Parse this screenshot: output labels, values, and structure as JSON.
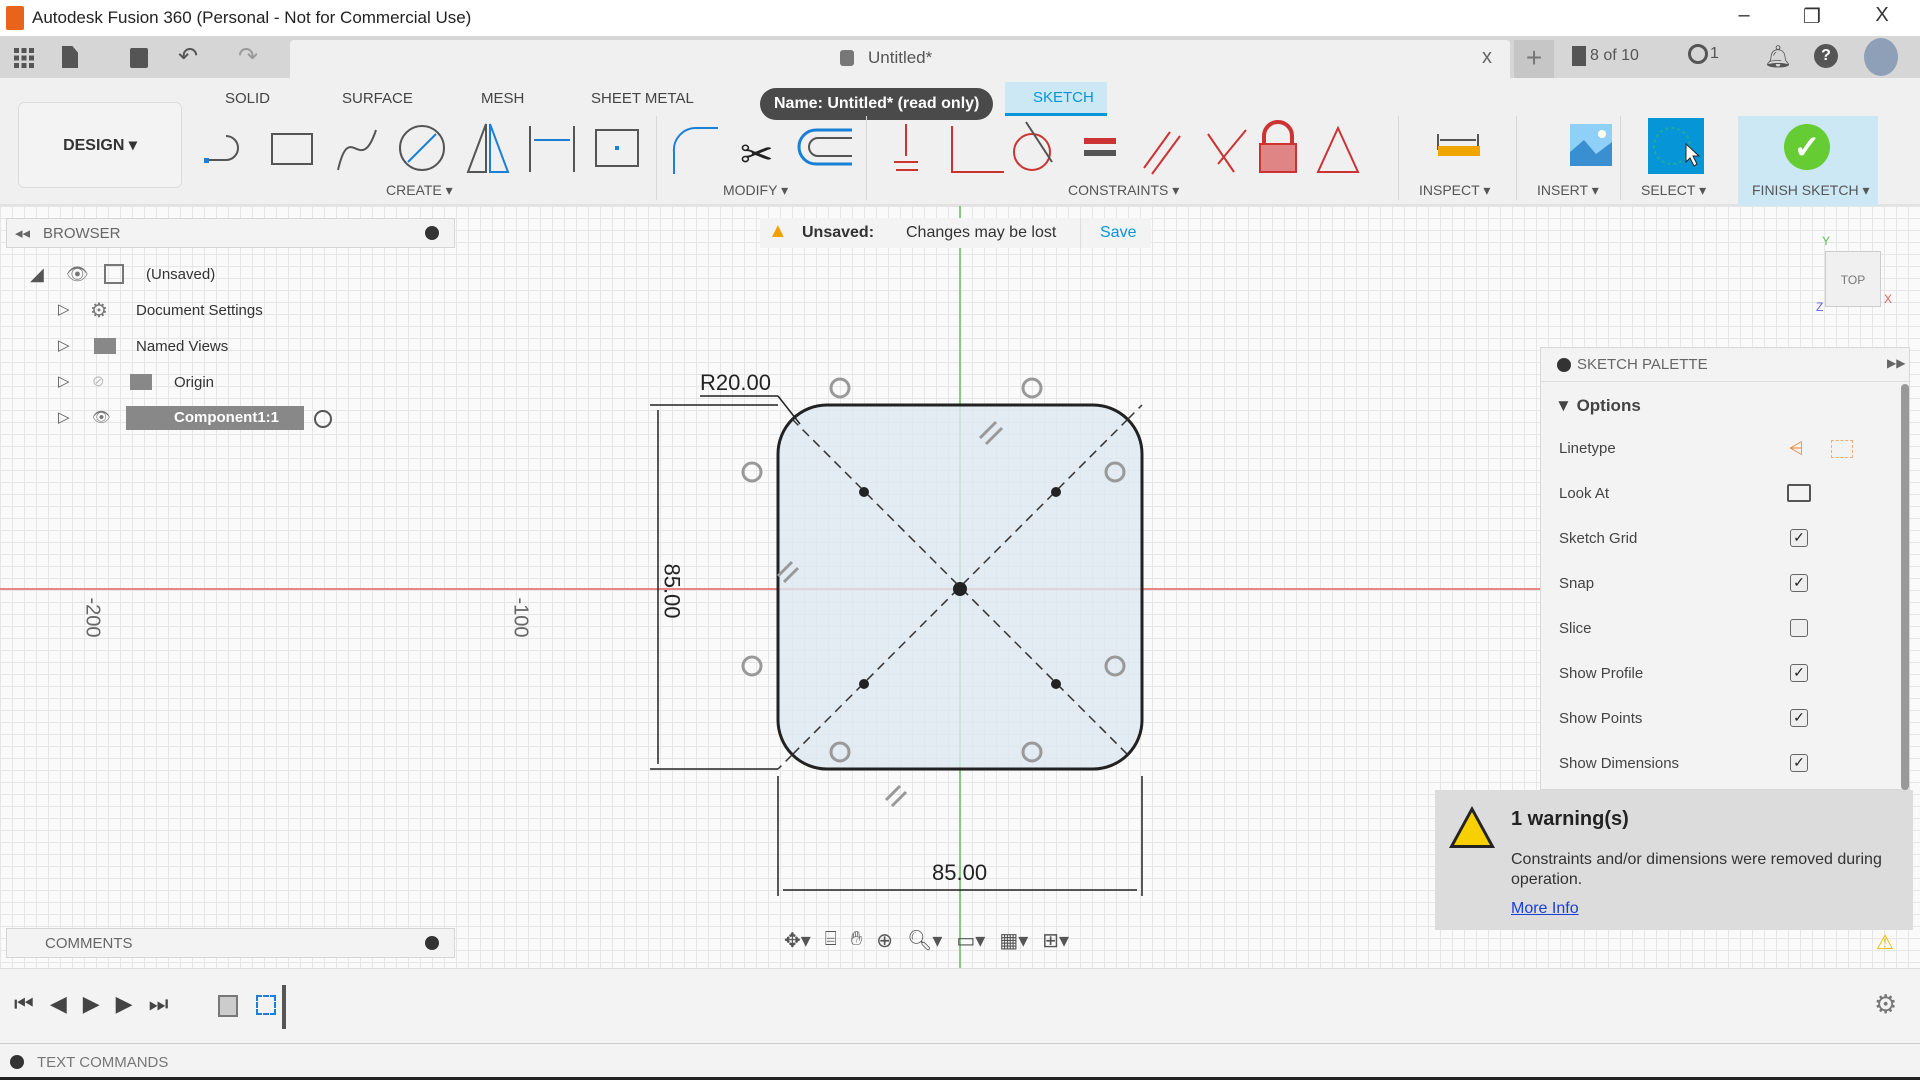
{
  "window": {
    "title": "Autodesk Fusion 360 (Personal - Not for Commercial Use)",
    "minimize": "–",
    "restore": "❐",
    "close": "X"
  },
  "qat": {
    "doc_tab": "Untitled*",
    "tab_close": "x",
    "jobs": "8 of 10",
    "clock_count": "1"
  },
  "tooltip": "Name: Untitled* (read only)",
  "ribbon": {
    "workspace": "DESIGN ▾",
    "tabs": [
      "SOLID",
      "SURFACE",
      "MESH",
      "SHEET METAL",
      "SKETCH"
    ],
    "active_tab": "SKETCH",
    "groups": [
      "CREATE ▾",
      "MODIFY ▾",
      "CONSTRAINTS ▾",
      "INSPECT ▾",
      "INSERT ▾",
      "SELECT ▾",
      "FINISH SKETCH ▾"
    ],
    "accent": "#0696d7"
  },
  "browser": {
    "title": "BROWSER",
    "items": [
      {
        "label": "(Unsaved)"
      },
      {
        "label": "Document Settings"
      },
      {
        "label": "Named Views"
      },
      {
        "label": "Origin"
      },
      {
        "label": "Component1:1"
      }
    ]
  },
  "unsaved": {
    "label": "Unsaved:",
    "message": "Changes may be lost",
    "save": "Save"
  },
  "viewcube": {
    "face": "TOP",
    "x": "X",
    "y": "Y",
    "z": "Z"
  },
  "sketch": {
    "radius": "R20.00",
    "height_dim": "85.00",
    "width_dim": "85.00",
    "axis_labels": [
      "-200",
      "-100"
    ]
  },
  "palette": {
    "title": "SKETCH PALETTE",
    "section": "Options",
    "rows": [
      {
        "label": "Linetype",
        "type": "icons"
      },
      {
        "label": "Look At",
        "type": "icon"
      },
      {
        "label": "Sketch Grid",
        "checked": true
      },
      {
        "label": "Snap",
        "checked": true
      },
      {
        "label": "Slice",
        "checked": false
      },
      {
        "label": "Show Profile",
        "checked": true
      },
      {
        "label": "Show Points",
        "checked": true
      },
      {
        "label": "Show Dimensions",
        "checked": true
      }
    ]
  },
  "warning": {
    "title": "1 warning(s)",
    "message": "Constraints and/or dimensions were removed during operation.",
    "link": "More Info"
  },
  "comments": {
    "title": "COMMENTS"
  },
  "textcommands": {
    "title": "TEXT COMMANDS"
  }
}
